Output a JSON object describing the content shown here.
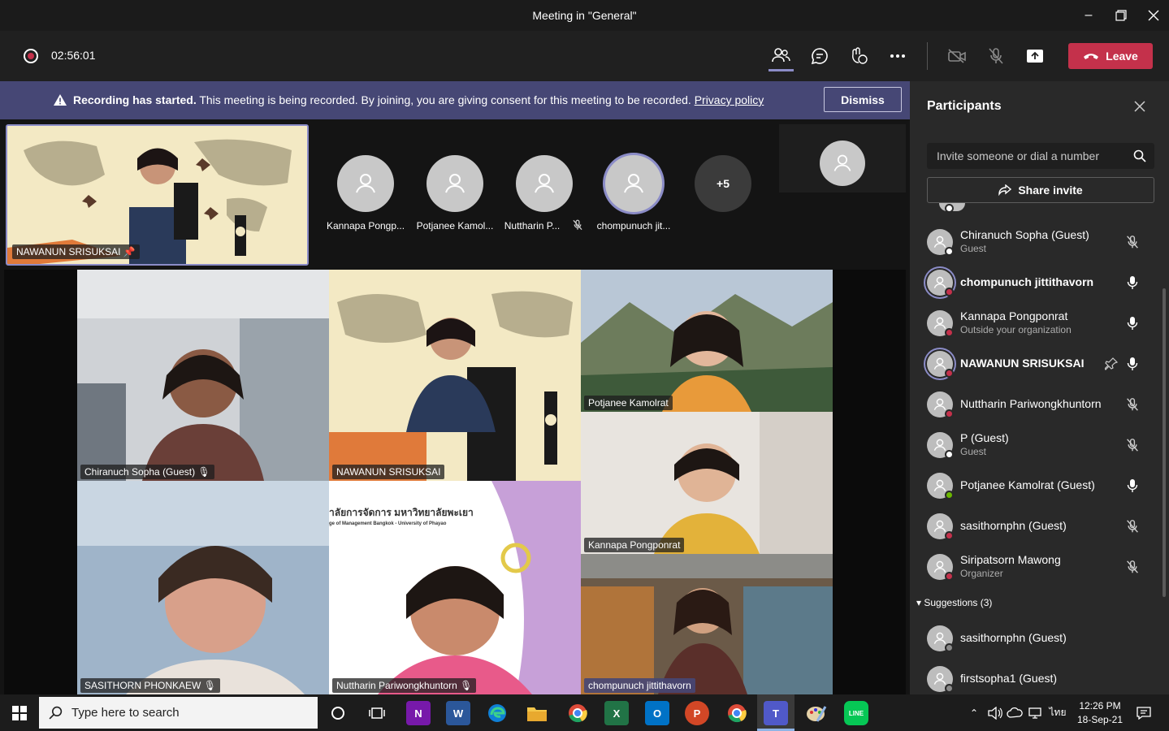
{
  "window": {
    "title": "Meeting in \"General\""
  },
  "toolbar": {
    "timer": "02:56:01",
    "leave_label": "Leave"
  },
  "banner": {
    "title": "Recording has started.",
    "message": " This meeting is being recorded. By joining, you are giving consent for this meeting to be recorded. ",
    "link": "Privacy policy",
    "dismiss_label": "Dismiss"
  },
  "stage": {
    "pinned_name": "NAWANUN SRISUKSAI",
    "avatars": [
      {
        "label": "Kannapa Pongp..."
      },
      {
        "label": "Potjanee Kamol..."
      },
      {
        "label": "Nuttharin P..."
      },
      {
        "label": "chompunuch jit..."
      }
    ],
    "more": "+5",
    "tiles": [
      {
        "name": "Chiranuch Sopha (Guest)"
      },
      {
        "name": "NAWANUN SRISUKSAI"
      },
      {
        "name": "Potjanee Kamolrat"
      },
      {
        "name": "SASITHORN PHONKAEW"
      },
      {
        "name": "Nuttharin Pariwongkhuntorn"
      },
      {
        "name": "Kannapa  Pongponrat"
      },
      {
        "name": "chompunuch jittithavorn"
      }
    ],
    "tile_text_th": "าลัยการจัดการ มหาวิทยาลัยพะเยา",
    "tile_text_en": "ge of Management Bangkok - University of Phayao"
  },
  "panel": {
    "title": "Participants",
    "invite_placeholder": "Invite someone or dial a number",
    "share_label": "Share invite",
    "participants": [
      {
        "name": "Chiranuch Sopha (Guest)",
        "sub": "Guest",
        "status": "#ffffff",
        "mic": "muted"
      },
      {
        "name": "chompunuch jittithavorn",
        "sub": "",
        "status": "#c4314b",
        "mic": "on",
        "bold": true
      },
      {
        "name": "Kannapa Pongponrat",
        "sub": "Outside your organization",
        "status": "#c4314b",
        "mic": "on"
      },
      {
        "name": "NAWANUN SRISUKSAI",
        "sub": "",
        "status": "#c4314b",
        "mic": "on",
        "bold": true
      },
      {
        "name": "Nuttharin Pariwongkhuntorn",
        "sub": "",
        "status": "#c4314b",
        "mic": "muted"
      },
      {
        "name": "P (Guest)",
        "sub": "Guest",
        "status": "#ffffff",
        "mic": "muted"
      },
      {
        "name": "Potjanee Kamolrat (Guest)",
        "sub": "",
        "status": "#6bb700",
        "mic": "on"
      },
      {
        "name": "sasithornphn (Guest)",
        "sub": "",
        "status": "#c4314b",
        "mic": "muted"
      },
      {
        "name": "Siripatsorn Mawong",
        "sub": "Organizer",
        "status": "#c4314b",
        "mic": "muted"
      }
    ],
    "suggestions_label": "Suggestions (3)",
    "suggestions": [
      {
        "name": "sasithornphn (Guest)"
      },
      {
        "name": "firstsopha1 (Guest)"
      }
    ]
  },
  "taskbar": {
    "search_placeholder": "Type here to search",
    "time": "12:26 PM",
    "date": "18-Sep-21",
    "lang": "ไทย"
  }
}
